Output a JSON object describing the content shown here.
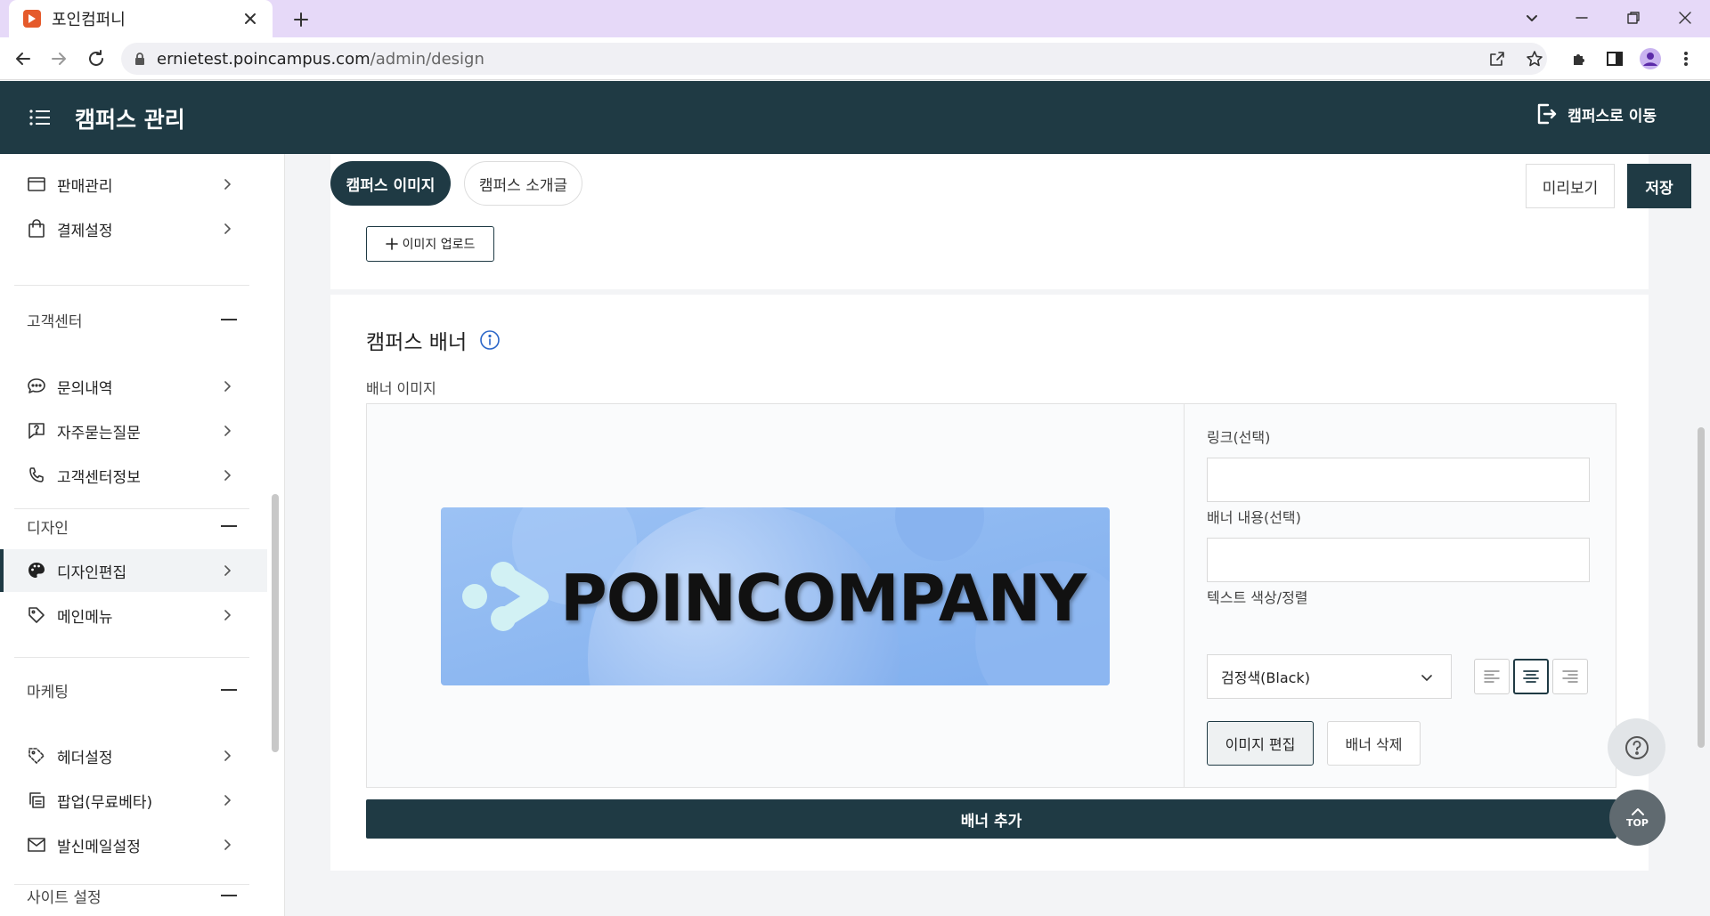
{
  "browser": {
    "tab_title": "포인컴퍼니",
    "url_host": "ernietest.poincampus.com",
    "url_path": "/admin/design"
  },
  "header": {
    "title": "캠퍼스 관리",
    "goto_campus": "캠퍼스로 이동"
  },
  "sidebar": {
    "items": [
      {
        "label": "판매관리",
        "icon": "card-icon"
      },
      {
        "label": "결제설정",
        "icon": "bag-icon"
      },
      {
        "label": "문의내역",
        "icon": "chat-icon"
      },
      {
        "label": "자주묻는질문",
        "icon": "question-icon"
      },
      {
        "label": "고객센터정보",
        "icon": "phone-icon"
      },
      {
        "label": "디자인편집",
        "icon": "palette-icon"
      },
      {
        "label": "메인메뉴",
        "icon": "tag-icon"
      },
      {
        "label": "헤더설정",
        "icon": "tag-outline-icon"
      },
      {
        "label": "팝업(무료베타)",
        "icon": "copy-icon"
      },
      {
        "label": "발신메일설정",
        "icon": "mail-icon"
      }
    ],
    "sections": [
      "고객센터",
      "디자인",
      "마케팅",
      "사이트 설정"
    ]
  },
  "toolbar": {
    "tab_image": "캠퍼스 이미지",
    "tab_intro": "캠퍼스 소개글",
    "preview": "미리보기",
    "save": "저장",
    "upload": "이미지 업로드"
  },
  "banner": {
    "section_title": "캠퍼스 배너",
    "image_label": "배너 이미지",
    "image_text": "POINCOMPANY",
    "link_label": "링크(선택)",
    "link_value": "",
    "content_label": "배너 내용(선택)",
    "content_value": "",
    "color_label": "텍스트 색상/정렬",
    "color_value": "검정색(Black)",
    "alignment": "center",
    "edit_image": "이미지 편집",
    "delete_banner": "배너 삭제",
    "add_banner": "배너 추가"
  },
  "fab": {
    "top": "TOP"
  },
  "colors": {
    "primary": "#1f3a44",
    "tab_bar": "#e6d9f8",
    "favicon": "#e55a2b"
  }
}
